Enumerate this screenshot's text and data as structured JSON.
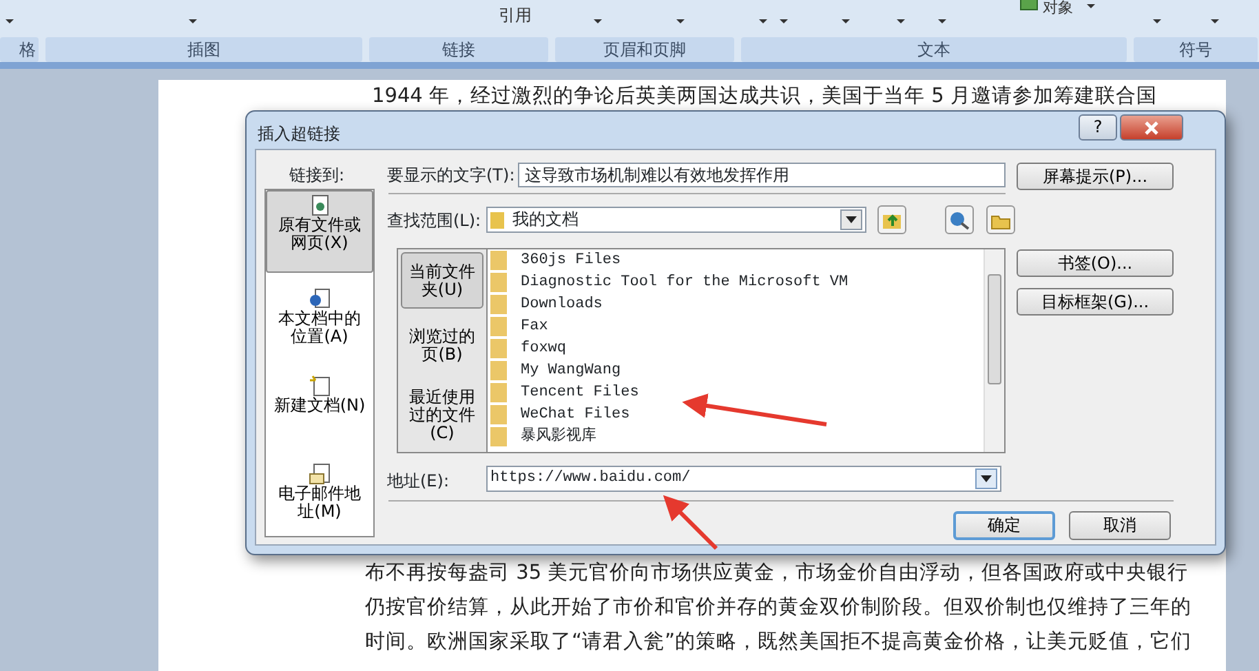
{
  "ribbon": {
    "top_texts": [
      {
        "kind": "quote",
        "label": "引用"
      },
      {
        "kind": "object",
        "label": "对象"
      }
    ],
    "groups": [
      "格",
      "插图",
      "链接",
      "页眉和页脚",
      "文本",
      "符号"
    ]
  },
  "document": {
    "lines_above": [
      "1944 年，经过激烈的争论后英美两国达成共识，美国于当年 5 月邀请参加筹建联合国"
    ],
    "lines_below": [
      "布不再按每盎司 35 美元官价向市场供应黄金，市场金价自由浮动，但各国政府或中央银行",
      "仍按官价结算，从此开始了市价和官价并存的黄金双价制阶段。但双价制也仅维持了三年的",
      "时间。欧洲国家采取了“请君入瓮”的策略，既然美国拒不提高黄金价格，让美元贬值，它们"
    ]
  },
  "dialog": {
    "title": "插入超链接",
    "help": "?",
    "link_to": {
      "label": "链接到:",
      "items": [
        {
          "label": "原有文件或网页(X)",
          "selected": true,
          "kind": "file"
        },
        {
          "label": "本文档中的位置(A)",
          "selected": false,
          "kind": "place"
        },
        {
          "label": "新建文档(N)",
          "selected": false,
          "kind": "new"
        },
        {
          "label": "电子邮件地址(M)",
          "selected": false,
          "kind": "mail"
        }
      ]
    },
    "display_text": {
      "label": "要显示的文字(T):",
      "value": "这导致市场机制难以有效地发挥作用"
    },
    "screen_tip_button": "屏幕提示(P)...",
    "look_in": {
      "label": "查找范围(L):",
      "value": "我的文档"
    },
    "browse_tabs": [
      {
        "label": "当前文件夹(U)",
        "selected": true
      },
      {
        "label": "浏览过的页(B)",
        "selected": false
      },
      {
        "label": "最近使用过的文件(C)",
        "selected": false
      }
    ],
    "files": [
      "360js Files",
      "Diagnostic Tool for the Microsoft VM",
      "Downloads",
      "Fax",
      "foxwq",
      "My WangWang",
      "Tencent Files",
      "WeChat Files",
      "暴风影视库"
    ],
    "side_buttons": [
      "书签(O)...",
      "目标框架(G)..."
    ],
    "address": {
      "label": "地址(E):",
      "value": "https://www.baidu.com/"
    },
    "buttons": [
      {
        "label": "确定",
        "kind": "default"
      },
      {
        "label": "取消",
        "kind": "normal"
      }
    ]
  }
}
